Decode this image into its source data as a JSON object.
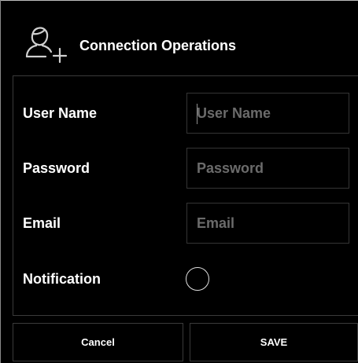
{
  "dialog": {
    "title": "Connection Operations",
    "header_icon": "user-add-icon"
  },
  "form": {
    "username": {
      "label": "User Name",
      "placeholder": "User Name",
      "value": ""
    },
    "password": {
      "label": "Password",
      "placeholder": "Password",
      "value": ""
    },
    "email": {
      "label": "Email",
      "placeholder": "Email",
      "value": ""
    },
    "notification": {
      "label": "Notification",
      "checked": false
    }
  },
  "buttons": {
    "cancel_label": "Cancel",
    "save_label": "SAVE"
  },
  "colors": {
    "background": "#000000",
    "text": "#ffffff",
    "placeholder": "#6b6b6b",
    "border": "#3a3a3a"
  }
}
